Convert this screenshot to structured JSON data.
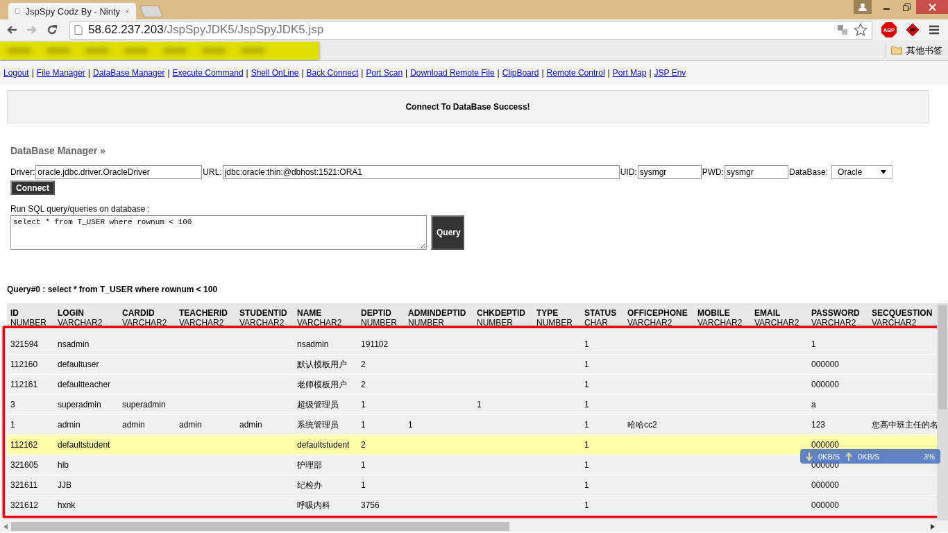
{
  "browser": {
    "tab_title": "JspSpy Codz By - Ninty",
    "url_host": "58.62.237.203",
    "url_path": "/JspSpyJDK5/JspSpyJDK5.jsp",
    "extension_badge": "ABP",
    "bookmark_folder": "其他书签"
  },
  "nav_separator": "|",
  "nav_links": [
    "Logout",
    "File Manager",
    "DataBase Manager",
    "Execute Command",
    "Shell OnLine",
    "Back Connect",
    "Port Scan",
    "Download Remote File",
    "ClipBoard",
    "Remote Control",
    "Port Map",
    "JSP Env"
  ],
  "status_message": "Connect To DataBase Success!",
  "section_title": "DataBase Manager »",
  "form": {
    "driver_label": "Driver:",
    "driver": "oracle.jdbc.driver.OracleDriver",
    "url_label": "URL:",
    "url": "jdbc:oracle:thin:@dbhost:1521:ORA1",
    "uid_label": "UID:",
    "uid": "sysmgr",
    "pwd_label": "PWD:",
    "pwd": "sysmgr",
    "database_label": "DataBase:",
    "database": "Oracle",
    "connect_button": "Connect",
    "sql_label": "Run SQL query/queries on database :",
    "sql": "select * from T_USER where rownum < 100",
    "query_button": "Query"
  },
  "query_title": "Query#0 : select * from T_USER where rownum < 100",
  "table": {
    "columns": [
      {
        "name": "ID",
        "type": "NUMBER"
      },
      {
        "name": "LOGIN",
        "type": "VARCHAR2"
      },
      {
        "name": "CARDID",
        "type": "VARCHAR2"
      },
      {
        "name": "TEACHERID",
        "type": "VARCHAR2"
      },
      {
        "name": "STUDENTID",
        "type": "VARCHAR2"
      },
      {
        "name": "NAME",
        "type": "VARCHAR2"
      },
      {
        "name": "DEPTID",
        "type": "NUMBER"
      },
      {
        "name": "ADMINDEPTID",
        "type": "NUMBER"
      },
      {
        "name": "CHKDEPTID",
        "type": "NUMBER"
      },
      {
        "name": "TYPE",
        "type": "NUMBER"
      },
      {
        "name": "STATUS",
        "type": "CHAR"
      },
      {
        "name": "OFFICEPHONE",
        "type": "VARCHAR2"
      },
      {
        "name": "MOBILE",
        "type": "VARCHAR2"
      },
      {
        "name": "EMAIL",
        "type": "VARCHAR2"
      },
      {
        "name": "PASSWORD",
        "type": "VARCHAR2"
      },
      {
        "name": "SECQUESTION",
        "type": "VARCHAR2"
      }
    ],
    "rows": [
      {
        "selected": false,
        "cells": [
          "321594",
          "nsadmin",
          null,
          null,
          null,
          "nsadmin",
          "191102",
          null,
          null,
          null,
          "1",
          null,
          null,
          null,
          "1",
          null
        ]
      },
      {
        "selected": false,
        "cells": [
          "112160",
          "defaultuser",
          null,
          null,
          null,
          "默认模板用户",
          "2",
          null,
          null,
          null,
          "1",
          null,
          null,
          null,
          "000000",
          null
        ]
      },
      {
        "selected": false,
        "cells": [
          "112161",
          "defaultteacher",
          null,
          null,
          null,
          "老师模板用户",
          "2",
          null,
          null,
          null,
          "1",
          null,
          null,
          null,
          "000000",
          null
        ]
      },
      {
        "selected": false,
        "cells": [
          "3",
          "superadmin",
          "superadmin",
          null,
          null,
          "超级管理员",
          "1",
          null,
          "1",
          null,
          "1",
          null,
          null,
          null,
          "a",
          null
        ]
      },
      {
        "selected": false,
        "cells": [
          "1",
          "admin",
          "admin",
          "admin",
          "admin",
          "系统管理员",
          "1",
          "1",
          null,
          null,
          "1",
          "哈哈cc2",
          null,
          null,
          "123",
          "您高中班主任的名"
        ]
      },
      {
        "selected": true,
        "cells": [
          "112162",
          "defaultstudent",
          null,
          null,
          null,
          "defaultstudent",
          "2",
          null,
          null,
          null,
          "1",
          null,
          null,
          null,
          "000000",
          null
        ]
      },
      {
        "selected": false,
        "cells": [
          "321605",
          "hlb",
          null,
          null,
          null,
          "护理部",
          "1",
          null,
          null,
          null,
          "1",
          null,
          null,
          null,
          "000000",
          null
        ]
      },
      {
        "selected": false,
        "cells": [
          "321611",
          "JJB",
          null,
          null,
          null,
          "纪检办",
          "1",
          null,
          null,
          null,
          "1",
          null,
          null,
          null,
          "000000",
          null
        ]
      },
      {
        "selected": false,
        "cells": [
          "321612",
          "hxnk",
          null,
          null,
          null,
          "呼吸内科",
          "3756",
          null,
          null,
          null,
          "1",
          null,
          null,
          null,
          "000000",
          null
        ]
      }
    ]
  },
  "speed_widget": {
    "download": "0KB/S",
    "upload": "0KB/S",
    "cpu": "3%"
  }
}
